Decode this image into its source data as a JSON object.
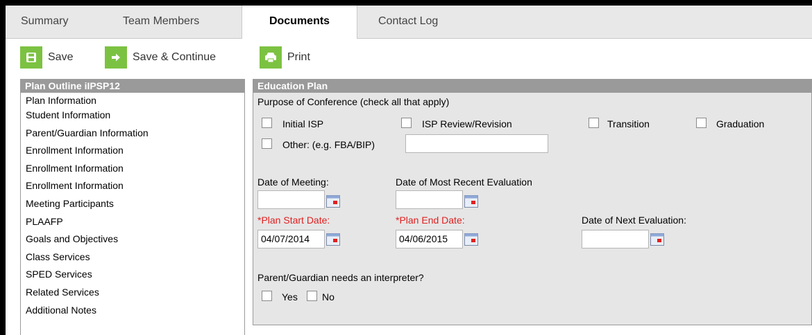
{
  "tabs": [
    "Summary",
    "Team Members",
    "Documents",
    "Contact Log"
  ],
  "active_tab": "Documents",
  "toolbar": {
    "save": "Save",
    "save_continue": "Save & Continue",
    "print": "Print"
  },
  "outline": {
    "title": "Plan Outline iIPSP12",
    "items": [
      "Plan Information",
      "Student Information",
      "Parent/Guardian Information",
      "Enrollment Information",
      "Enrollment Information",
      "Enrollment Information",
      "Meeting Participants",
      "PLAAFP",
      "Goals and Objectives",
      "Class Services",
      "SPED Services",
      "Related Services",
      "Additional Notes"
    ]
  },
  "education_plan": {
    "title": "Education Plan",
    "purpose_label": "Purpose of Conference (check all that apply)",
    "purpose_options": {
      "initial_isp": "Initial ISP",
      "isp_review": "ISP Review/Revision",
      "transition": "Transition",
      "graduation": "Graduation",
      "other": "Other: (e.g. FBA/BIP)"
    },
    "other_value": "",
    "date_of_meeting_label": "Date of Meeting:",
    "date_of_meeting_value": "",
    "recent_eval_label": "Date of Most Recent Evaluation",
    "recent_eval_value": "",
    "plan_start_label": "*Plan Start Date:",
    "plan_start_value": "04/07/2014",
    "plan_end_label": "*Plan End Date:",
    "plan_end_value": "04/06/2015",
    "next_eval_label": "Date of Next Evaluation:",
    "next_eval_value": "",
    "interpreter_label": "Parent/Guardian needs an interpreter?",
    "yes_label": "Yes",
    "no_label": "No"
  },
  "colors": {
    "toolbar_icon": "#7cc242",
    "panel_header": "#9a9a9a",
    "required": "#e02020",
    "panel_bg": "#e6e6e6"
  },
  "icons": {
    "save": "floppy-disk-icon",
    "save_continue": "arrow-right-icon",
    "print": "printer-icon",
    "calendar": "calendar-icon"
  }
}
